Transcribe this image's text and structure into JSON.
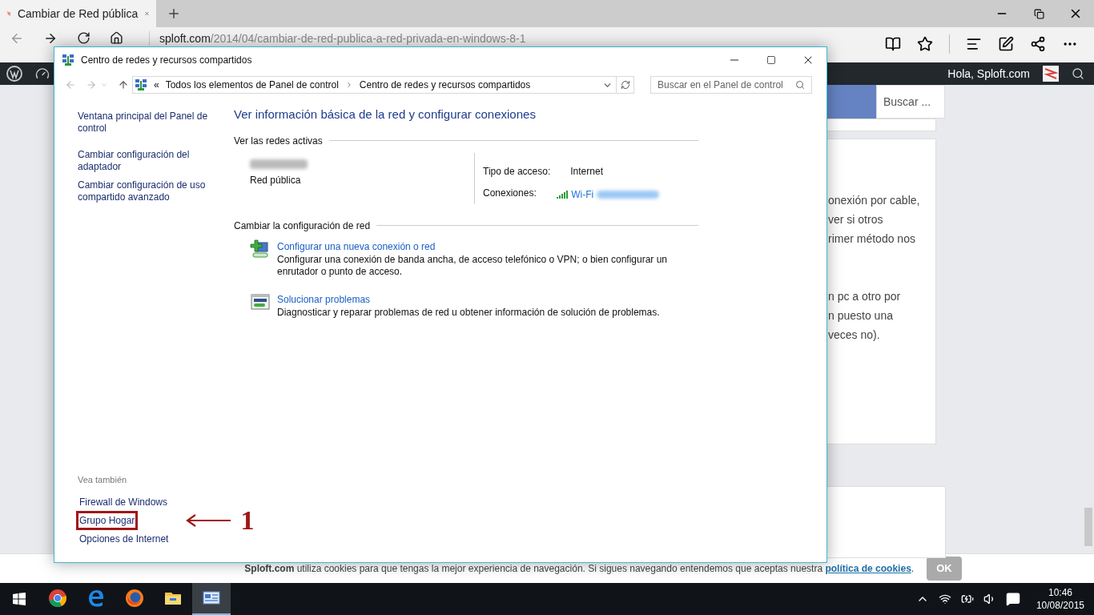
{
  "browser": {
    "tab": {
      "title": "Cambiar de Red pública",
      "selected": true
    },
    "address": {
      "domain": "sploft.com",
      "path": "/2014/04/cambiar-de-red-publica-a-red-privada-en-windows-8-1"
    }
  },
  "admin_bar": {
    "greeting": "Hola, Sploft.com"
  },
  "page": {
    "search": {
      "placeholder": "Buscar ..."
    },
    "article_lines": [
      {
        "text": "onexión por cable,"
      },
      {
        "text": "ver si otros"
      },
      {
        "text": "rimer método nos"
      },
      {
        "text": "n pc a otro por",
        "gap": true
      },
      {
        "text": "n puesto una"
      },
      {
        "text": "veces no)."
      }
    ]
  },
  "window": {
    "title": "Centro de redes y recursos compartidos",
    "breadcrumb": {
      "overflow": "«",
      "items": [
        "Todos los elementos de Panel de control",
        "Centro de redes y recursos compartidos"
      ]
    },
    "search": {
      "placeholder": "Buscar en el Panel de control"
    },
    "sidebar": {
      "links": [
        "Ventana principal del Panel de control",
        "Cambiar configuración del adaptador",
        "Cambiar configuración de uso compartido avanzado"
      ],
      "see_also": {
        "heading": "Vea también",
        "links": [
          {
            "label": "Firewall de Windows",
            "annotated": false
          },
          {
            "label": "Grupo Hogar",
            "annotated": true
          },
          {
            "label": "Opciones de Internet",
            "annotated": false
          }
        ]
      }
    },
    "heading": "Ver información básica de la red y configurar conexiones",
    "active_networks": {
      "title": "Ver las redes activas",
      "network_type": "Red pública",
      "access_label": "Tipo de acceso:",
      "access_value": "Internet",
      "connections_label": "Conexiones:",
      "connection": "Wi-Fi"
    },
    "change_settings": {
      "title": "Cambiar la configuración de red",
      "tasks": [
        {
          "kind": "new-connection",
          "title": "Configurar una nueva conexión o red",
          "description": "Configurar una conexión de banda ancha, de acceso telefónico o VPN; o bien configurar un enrutador o punto de acceso."
        },
        {
          "kind": "troubleshoot",
          "title": "Solucionar problemas",
          "description": "Diagnosticar y reparar problemas de red u obtener información de solución de problemas."
        }
      ]
    }
  },
  "annotation": {
    "label": "1"
  },
  "cookie_bar": {
    "text": "**Sploft.com** utiliza cookies para que tengas la mejor experiencia de navegación. Si sigues navegando entendemos que aceptas nuestra",
    "link": "política de cookies",
    "after": ".",
    "button": "OK"
  },
  "taskbar": {
    "apps": [
      {
        "kind": "chrome",
        "selected": false
      },
      {
        "kind": "edge",
        "selected": false
      },
      {
        "kind": "firefox",
        "selected": false
      },
      {
        "kind": "explorer",
        "selected": false
      },
      {
        "kind": "control-panel",
        "selected": true
      }
    ],
    "time": "10:46",
    "date": "10/08/2015"
  }
}
